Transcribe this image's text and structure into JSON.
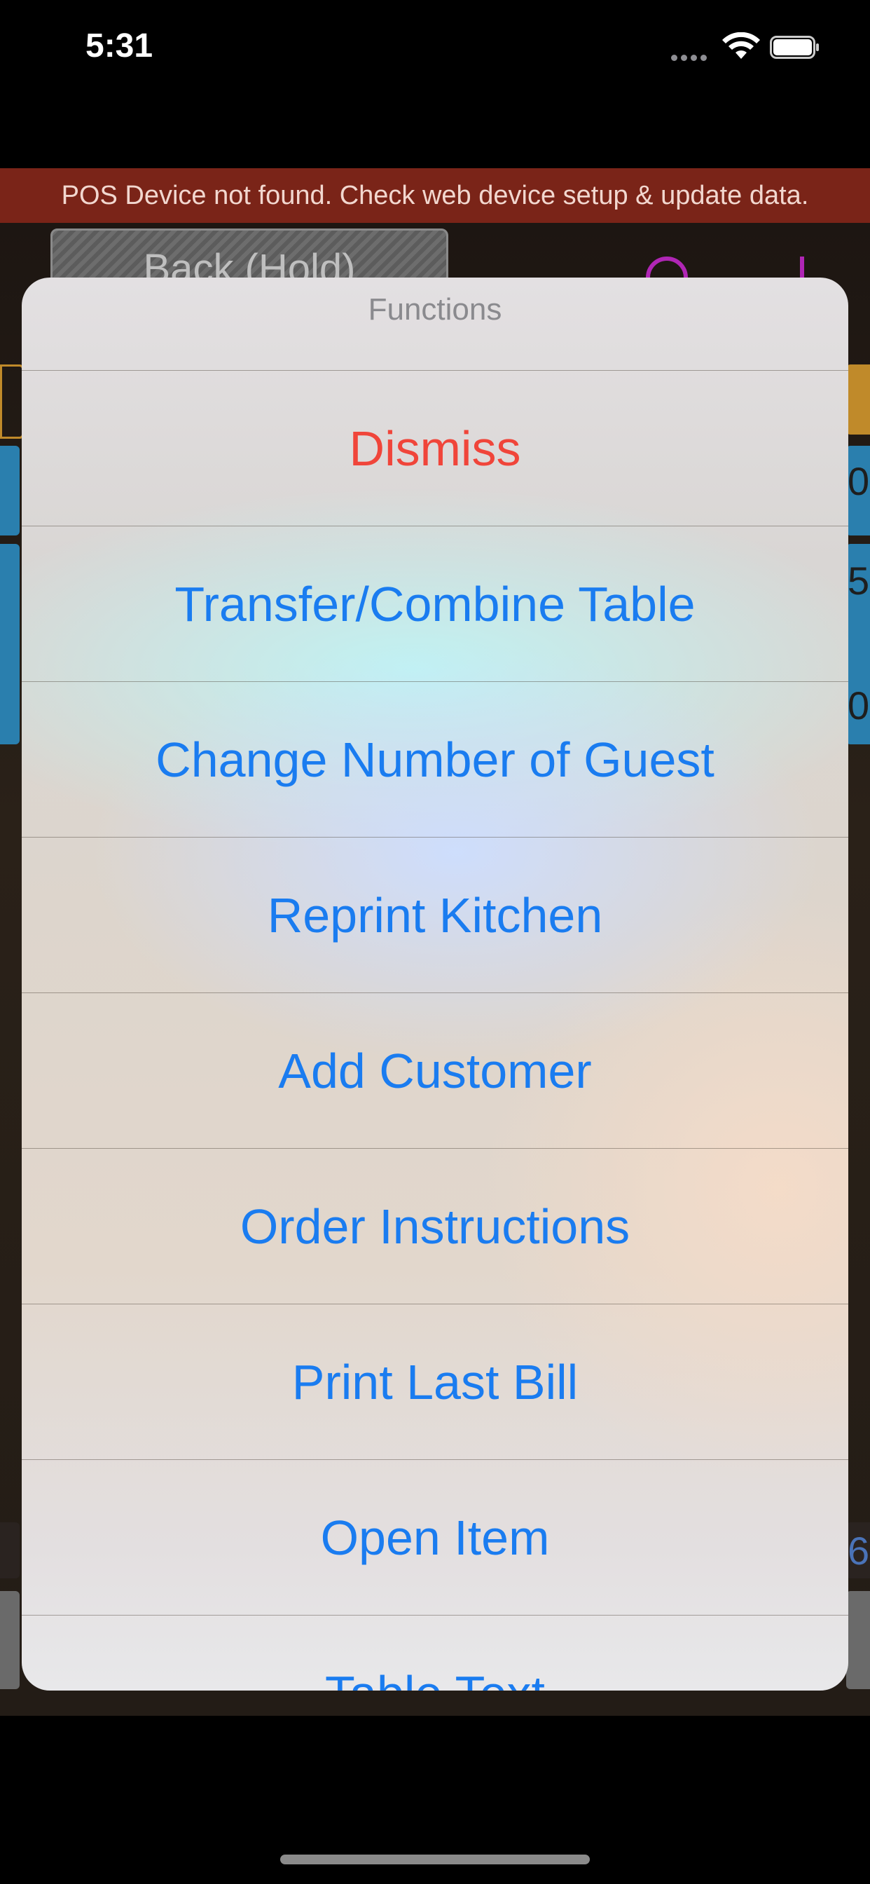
{
  "status_bar": {
    "time": "5:31",
    "icons": [
      "signal-dots-icon",
      "wifi-icon",
      "battery-icon"
    ]
  },
  "banner": {
    "text": "POS Device not found. Check web device setup & update data."
  },
  "background": {
    "back_button_label": "Back (Hold)",
    "side_digits": [
      "0",
      "5",
      "0",
      "6"
    ]
  },
  "action_sheet": {
    "title": "Functions",
    "items": [
      {
        "label": "Dismiss",
        "style": "destructive"
      },
      {
        "label": "Transfer/Combine Table",
        "style": "default"
      },
      {
        "label": "Change Number of Guest",
        "style": "default"
      },
      {
        "label": "Reprint Kitchen",
        "style": "default"
      },
      {
        "label": "Add Customer",
        "style": "default"
      },
      {
        "label": "Order Instructions",
        "style": "default"
      },
      {
        "label": "Print Last Bill",
        "style": "default"
      },
      {
        "label": "Open Item",
        "style": "default"
      },
      {
        "label": "Table Text",
        "style": "default"
      }
    ]
  },
  "colors": {
    "action_blue": "#1a7cf0",
    "destructive_red": "#f0453a",
    "banner_red": "#7a2418",
    "accent_purple": "#b026b5"
  }
}
